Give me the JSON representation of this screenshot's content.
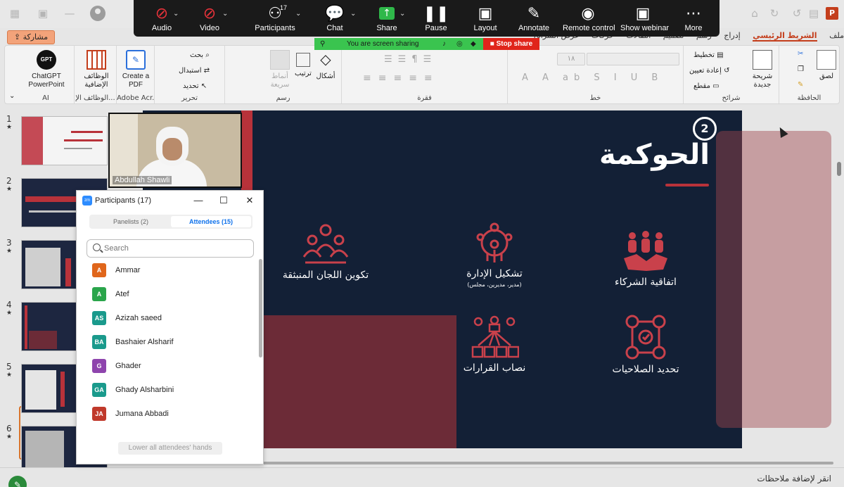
{
  "zoom_toolbar": {
    "audio_label": "Audio",
    "video_label": "Video",
    "participants_label": "Participants",
    "participants_count": "17",
    "chat_label": "Chat",
    "share_label": "Share",
    "pause_label": "Pause",
    "layout_label": "Layout",
    "annotate_label": "Annotate",
    "remote_control_label": "Remote control",
    "show_webinar_label": "Show webinar",
    "more_label": "More"
  },
  "share_banner": {
    "text": "You are screen sharing",
    "stop_label": "Stop share"
  },
  "ppt": {
    "share_button": "مشاركة",
    "tabs": [
      "ملف",
      "الشريط الرئيسي",
      "إدراج",
      "رسم",
      "تصميم",
      "انتقالات",
      "حركات",
      "عرض الشرائح"
    ],
    "groups": {
      "ai_label": "AI",
      "addins_label": "الوظائف الإ...",
      "adobe_label": "Adobe Acr...",
      "edit_label": "تحرير",
      "draw_label": "رسم",
      "paragraph_label": "فقرة",
      "font_label": "خط",
      "slides_label": "شرائح",
      "clipboard_label": "الحافظة"
    },
    "buttons": {
      "chatgpt": "ChatGPT PowerPoint",
      "chatgpt_icon": "GPT",
      "addins": "الوظائف الإضافية",
      "create_pdf": "Create a PDF",
      "find": "بحث",
      "replace": "استبدال",
      "select": "تحديد",
      "shapes": "أشكال",
      "arrange": "ترتيب",
      "quick_styles": "أنماط سريعة",
      "layout": "تخطيط",
      "reset": "إعادة تعيين",
      "section": "مقطع",
      "new_slide": "شريحة جديدة",
      "paste": "لصق",
      "font_size": "١٨"
    },
    "slide_numbers": [
      "1",
      "2",
      "3",
      "4",
      "5",
      "6"
    ],
    "notes_placeholder": "انقر لإضافة ملاحظات"
  },
  "slide": {
    "number": "2",
    "title": "الحوكمة",
    "items": [
      {
        "label": "تكوين اللجان المنبثقة",
        "sub": ""
      },
      {
        "label": "تشكيل الإدارة",
        "sub": "(مدير، مديرين، مجلس)"
      },
      {
        "label": "اتفاقية الشركاء",
        "sub": ""
      },
      {
        "label": "نصاب القرارات",
        "sub": ""
      },
      {
        "label": "تحديد الصلاحيات",
        "sub": ""
      }
    ],
    "accent_color": "#b8323a",
    "background_color": "#132036"
  },
  "webcam": {
    "name": "Abdullah Shawli"
  },
  "participants_panel": {
    "title": "Participants (17)",
    "tab_panelists": "Panelists (2)",
    "tab_attendees": "Attendees (15)",
    "search_placeholder": "Search",
    "attendees": [
      {
        "initials": "A",
        "name": "Ammar",
        "color": "#e0661b"
      },
      {
        "initials": "A",
        "name": "Atef",
        "color": "#2aa54b"
      },
      {
        "initials": "AS",
        "name": "Azizah saeed",
        "color": "#1a9a8c"
      },
      {
        "initials": "BA",
        "name": "Bashaier Alsharif",
        "color": "#1a9a8c"
      },
      {
        "initials": "G",
        "name": "Ghader",
        "color": "#8e44ad"
      },
      {
        "initials": "GA",
        "name": "Ghady Alsharbini",
        "color": "#1a9a8c"
      },
      {
        "initials": "JA",
        "name": "Jumana Abbadi",
        "color": "#c0392b"
      }
    ],
    "lower_hands_label": "Lower all attendees' hands"
  }
}
